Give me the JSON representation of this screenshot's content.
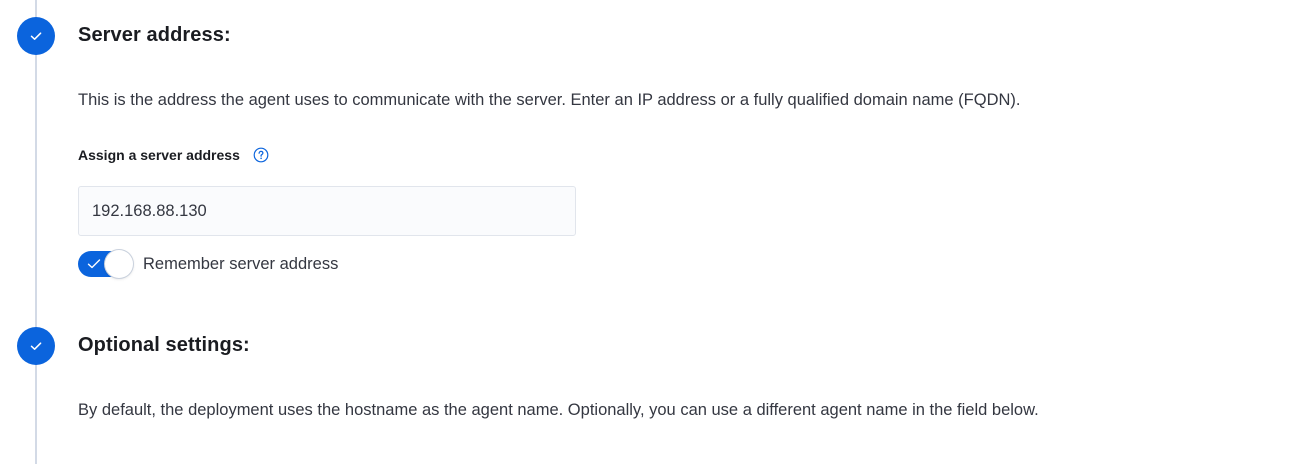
{
  "colors": {
    "accent": "#0b64dd",
    "rail": "#d3dae6"
  },
  "steps": [
    {
      "status_icon": "check-icon",
      "title": "Server address:",
      "description": "This is the address the agent uses to communicate with the server. Enter an IP address or a fully qualified domain name (FQDN)."
    },
    {
      "status_icon": "check-icon",
      "title": "Optional settings:",
      "description": "By default, the deployment uses the hostname as the agent name. Optionally, you can use a different agent name in the field below."
    }
  ],
  "server_field": {
    "label": "Assign a server address",
    "help_icon": "question-circle-icon",
    "value": "192.168.88.130"
  },
  "remember_toggle": {
    "label": "Remember server address",
    "checked": true
  }
}
